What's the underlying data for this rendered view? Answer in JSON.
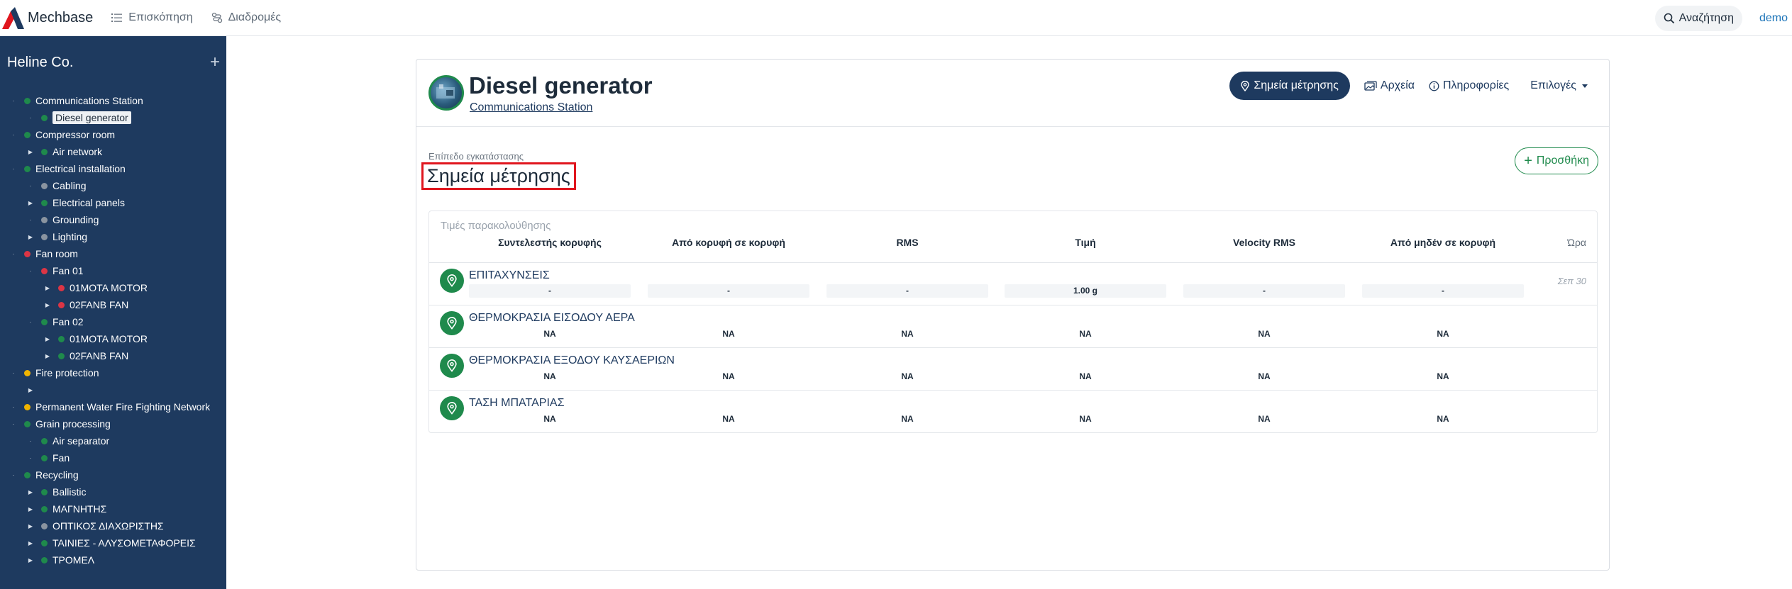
{
  "navbar": {
    "brand": "Mechbase",
    "links": [
      {
        "label": "Επισκόπηση",
        "icon": "list-icon"
      },
      {
        "label": "Διαδρομές",
        "icon": "route-icon"
      }
    ],
    "search_label": "Αναζήτηση",
    "user": "demo"
  },
  "sidebar": {
    "org": "Heline Co.",
    "add_symbol": "+",
    "colors": {
      "green": "#1f8a4c",
      "red": "#dc3545",
      "yellow": "#f0b400",
      "gray": "#8a94a0"
    },
    "tree": [
      {
        "label": "Communications Station",
        "level": 0,
        "status": "green",
        "caret": "none"
      },
      {
        "label": "Diesel generator",
        "level": 1,
        "status": "green",
        "caret": "none",
        "selected": true
      },
      {
        "label": "Compressor room",
        "level": 0,
        "status": "green",
        "caret": "none"
      },
      {
        "label": "Air network",
        "level": 1,
        "status": "green",
        "caret": "right"
      },
      {
        "label": "Electrical installation",
        "level": 0,
        "status": "green",
        "caret": "none"
      },
      {
        "label": "Cabling",
        "level": 1,
        "status": "gray",
        "caret": "none"
      },
      {
        "label": "Electrical panels",
        "level": 1,
        "status": "green",
        "caret": "right"
      },
      {
        "label": "Grounding",
        "level": 1,
        "status": "gray",
        "caret": "none"
      },
      {
        "label": "Lighting",
        "level": 1,
        "status": "gray",
        "caret": "right"
      },
      {
        "label": "Fan room",
        "level": 0,
        "status": "red",
        "caret": "none"
      },
      {
        "label": "Fan 01",
        "level": 1,
        "status": "red",
        "caret": "none"
      },
      {
        "label": "01MOTA MOTOR",
        "level": 2,
        "status": "red",
        "caret": "right"
      },
      {
        "label": "02FANB FAN",
        "level": 2,
        "status": "red",
        "caret": "right"
      },
      {
        "label": "Fan 02",
        "level": 1,
        "status": "green",
        "caret": "none"
      },
      {
        "label": "01MOTA MOTOR",
        "level": 2,
        "status": "green",
        "caret": "right"
      },
      {
        "label": "02FANB FAN",
        "level": 2,
        "status": "green",
        "caret": "right"
      },
      {
        "label": "Fire protection",
        "level": 0,
        "status": "yellow",
        "caret": "none"
      },
      {
        "label": "",
        "level": 1,
        "status": "none",
        "caret": "right"
      },
      {
        "label": "Permanent Water Fire Fighting Network",
        "level": 0,
        "status": "yellow",
        "caret": "none"
      },
      {
        "label": "Grain processing",
        "level": 0,
        "status": "green",
        "caret": "none"
      },
      {
        "label": "Air separator",
        "level": 1,
        "status": "green",
        "caret": "none"
      },
      {
        "label": "Fan",
        "level": 1,
        "status": "green",
        "caret": "none"
      },
      {
        "label": "Recycling",
        "level": 0,
        "status": "green",
        "caret": "none"
      },
      {
        "label": "Ballistic",
        "level": 1,
        "status": "green",
        "caret": "right"
      },
      {
        "label": "ΜΑΓΝΗΤΗΣ",
        "level": 1,
        "status": "green",
        "caret": "right"
      },
      {
        "label": "ΟΠΤΙΚΟΣ ΔΙΑΧΩΡΙΣΤΗΣ",
        "level": 1,
        "status": "gray",
        "caret": "right"
      },
      {
        "label": "ΤΑΙΝΙΕΣ - ΑΛΥΣΟΜΕΤΑΦΟΡΕΙΣ",
        "level": 1,
        "status": "green",
        "caret": "right"
      },
      {
        "label": "ΤΡΟΜΕΛ",
        "level": 1,
        "status": "green",
        "caret": "right"
      }
    ]
  },
  "asset": {
    "title": "Diesel generator",
    "parent": "Communications Station"
  },
  "header_actions": {
    "measurement_points": "Σημεία μέτρησης",
    "files": "Αρχεία",
    "info": "Πληροφορίες",
    "options": "Επιλογές"
  },
  "section": {
    "subtitle": "Επίπεδο εγκατάστασης",
    "title": "Σημεία μέτρησης",
    "add_label": "Προσθήκη",
    "add_symbol": "+"
  },
  "monitoring": {
    "caption": "Τιμές παρακολούθησης",
    "columns": [
      "Συντελεστής κορυφής",
      "Από κορυφή σε κορυφή",
      "RMS",
      "Τιμή",
      "Velocity RMS",
      "Από μηδέν σε κορυφή"
    ],
    "time_header": "Ώρα",
    "rows": [
      {
        "name": "ΕΠΙΤΑΧΥΝΣΕΙΣ",
        "values": [
          "-",
          "-",
          "-",
          "1.00 g",
          "-",
          "-"
        ],
        "date": "Σεπ 30",
        "boxed": true
      },
      {
        "name": "ΘΕΡΜΟΚΡΑΣΙΑ ΕΙΣΟΔΟΥ ΑΕΡΑ",
        "values": [
          "NA",
          "NA",
          "NA",
          "NA",
          "NA",
          "NA"
        ],
        "date": "",
        "boxed": false
      },
      {
        "name": "ΘΕΡΜΟΚΡΑΣΙΑ ΕΞΟΔΟΥ ΚΑΥΣΑΕΡΙΩΝ",
        "values": [
          "NA",
          "NA",
          "NA",
          "NA",
          "NA",
          "NA"
        ],
        "date": "",
        "boxed": false
      },
      {
        "name": "ΤΑΣΗ ΜΠΑΤΑΡΙΑΣ",
        "values": [
          "NA",
          "NA",
          "NA",
          "NA",
          "NA",
          "NA"
        ],
        "date": "",
        "boxed": false
      }
    ]
  }
}
